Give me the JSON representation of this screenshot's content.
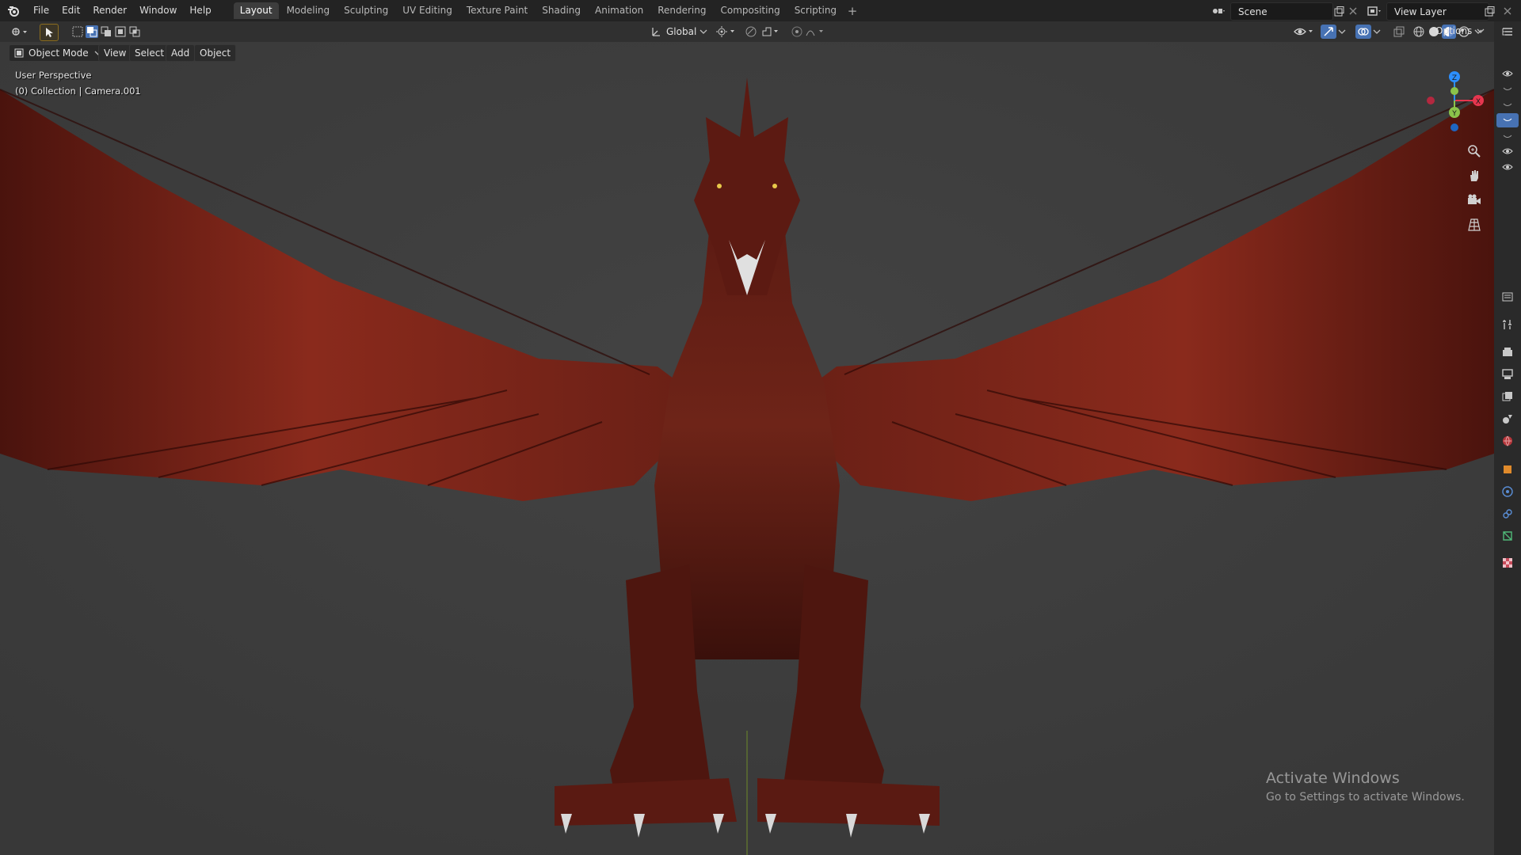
{
  "menu": [
    "File",
    "Edit",
    "Render",
    "Window",
    "Help"
  ],
  "workspaces": [
    "Layout",
    "Modeling",
    "Sculpting",
    "UV Editing",
    "Texture Paint",
    "Shading",
    "Animation",
    "Rendering",
    "Compositing",
    "Scripting"
  ],
  "workspace_add": "+",
  "scene": {
    "label": "Scene"
  },
  "view_layer": {
    "label": "View Layer"
  },
  "toolbar": {
    "transform_orientation": "Global",
    "options": "Options"
  },
  "viewport_header": {
    "mode": "Object Mode",
    "menus": [
      "View",
      "Select",
      "Add",
      "Object"
    ]
  },
  "viewport_overlay": {
    "perspective": "User Perspective",
    "collection": "(0) Collection | Camera.001"
  },
  "gizmo_axes": {
    "x": "X",
    "y": "Y",
    "z": "Z"
  },
  "watermark": {
    "title": "Activate Windows",
    "subtitle": "Go to Settings to activate Windows."
  },
  "colors": {
    "accent": "#4772b3",
    "dragon": "#8a2a1c",
    "x_axis": "#e6364f",
    "y_axis": "#8bc34a",
    "z_axis": "#2c8fff"
  }
}
